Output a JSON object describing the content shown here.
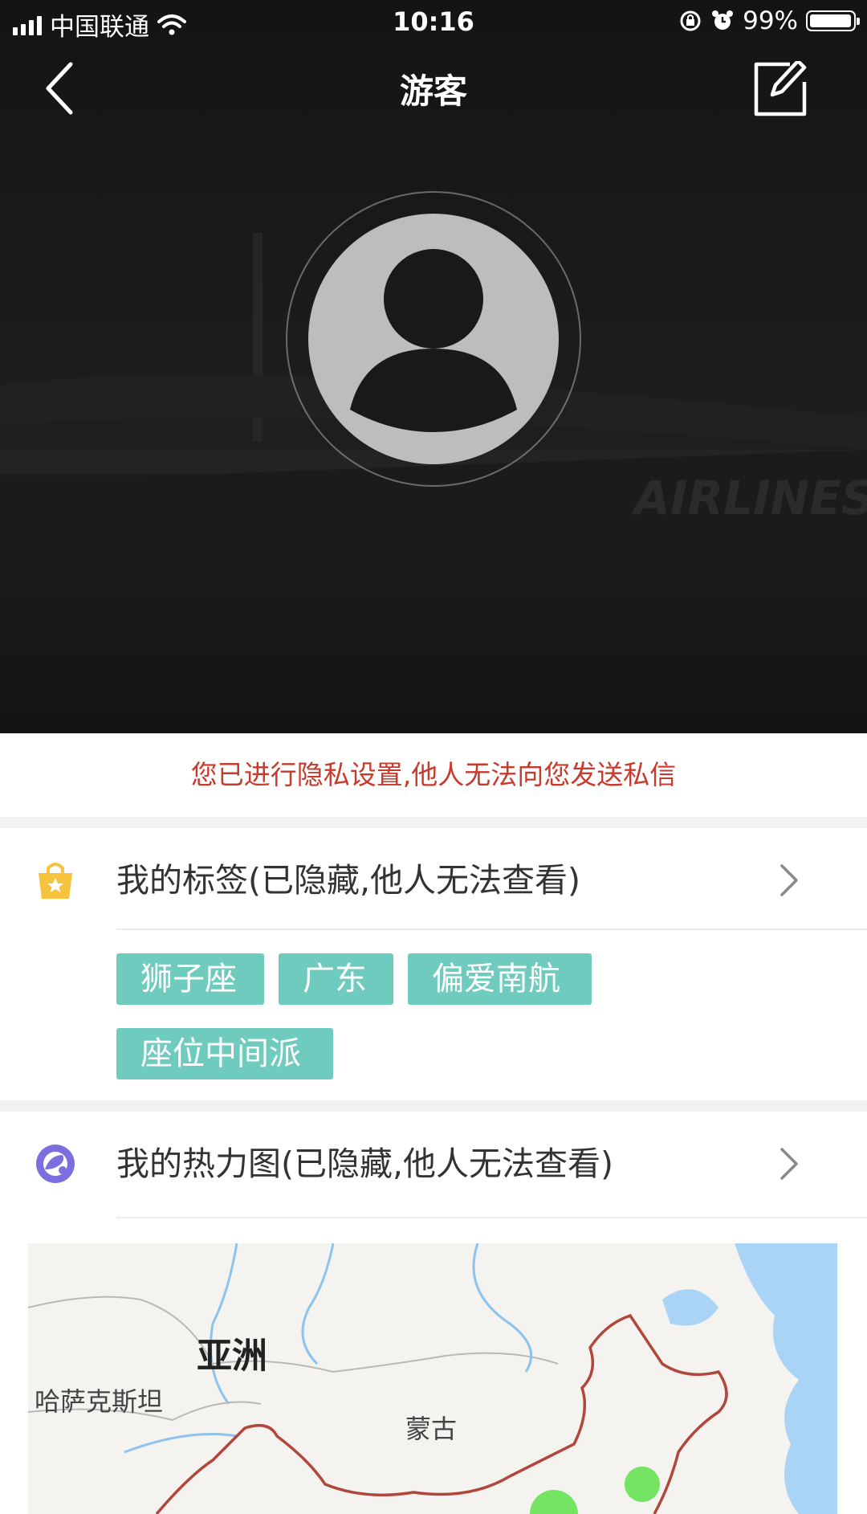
{
  "status_bar": {
    "carrier": "中国联通",
    "time": "10:16",
    "battery": "99%",
    "battery_level": 0.99
  },
  "nav": {
    "title": "游客",
    "back_icon": "chevron-left-icon",
    "edit_icon": "edit-icon"
  },
  "profile": {
    "avatar_icon": "default-avatar-icon",
    "background_watermark": "AIRLINES"
  },
  "privacy_notice": "您已进行隐私设置,他人无法向您发送私信",
  "tags_section": {
    "icon": "shopping-bag-star-icon",
    "label": "我的标签(已隐藏,他人无法查看)",
    "tags": [
      "狮子座",
      "广东",
      "偏爱南航",
      "座位中间派"
    ]
  },
  "heatmap_section": {
    "icon": "heatmap-icon",
    "label": "我的热力图(已隐藏,他人无法查看)"
  },
  "map": {
    "labels": {
      "continent": "亚洲",
      "kazakhstan": "哈萨克斯坦",
      "mongolia": "蒙古"
    }
  },
  "colors": {
    "privacy_text": "#c83a2c",
    "tag_bg": "#6fcbbd",
    "heat_spot": "#5fe04a",
    "border": "#b0463c",
    "water": "#a9d4f5"
  }
}
